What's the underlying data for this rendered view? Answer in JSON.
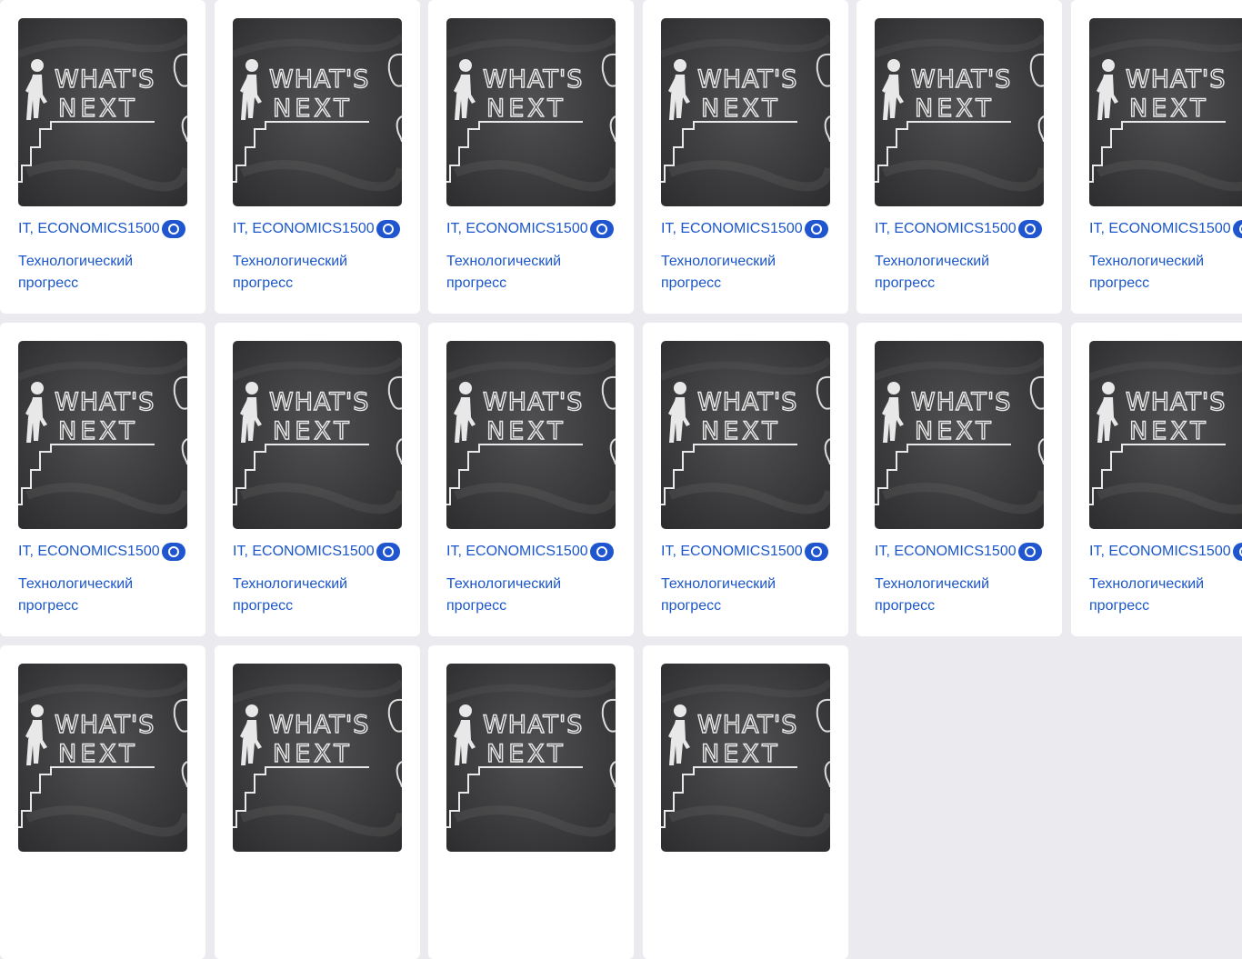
{
  "cards": [
    {
      "tags": "IT, ECONOMICS",
      "views": "1500",
      "title": "Технологический прогресс",
      "image": "chalkboard-whats-next"
    },
    {
      "tags": "IT, ECONOMICS",
      "views": "1500",
      "title": "Технологический прогресс",
      "image": "chalkboard-whats-next"
    },
    {
      "tags": "IT, ECONOMICS",
      "views": "1500",
      "title": "Технологический прогресс",
      "image": "chalkboard-whats-next"
    },
    {
      "tags": "IT, ECONOMICS",
      "views": "1500",
      "title": "Технологический прогресс",
      "image": "chalkboard-whats-next"
    },
    {
      "tags": "IT, ECONOMICS",
      "views": "1500",
      "title": "Технологический прогресс",
      "image": "chalkboard-whats-next"
    },
    {
      "tags": "IT, ECONOMICS",
      "views": "1500",
      "title": "Технологический прогресс",
      "image": "chalkboard-whats-next"
    },
    {
      "tags": "IT, ECONOMICS",
      "views": "1500",
      "title": "Технологический прогресс",
      "image": "chalkboard-whats-next"
    },
    {
      "tags": "IT, ECONOMICS",
      "views": "1500",
      "title": "Технологический прогресс",
      "image": "chalkboard-whats-next"
    },
    {
      "tags": "IT, ECONOMICS",
      "views": "1500",
      "title": "Технологический прогресс",
      "image": "chalkboard-whats-next"
    },
    {
      "tags": "IT, ECONOMICS",
      "views": "1500",
      "title": "Технологический прогресс",
      "image": "chalkboard-whats-next"
    },
    {
      "tags": "IT, ECONOMICS",
      "views": "1500",
      "title": "Технологический прогресс",
      "image": "chalkboard-whats-next"
    },
    {
      "tags": "IT, ECONOMICS",
      "views": "1500",
      "title": "Технологический прогресс",
      "image": "chalkboard-whats-next"
    },
    {
      "tags": "",
      "views": "",
      "title": "",
      "image": "chalkboard-whats-next"
    },
    {
      "tags": "",
      "views": "",
      "title": "",
      "image": "chalkboard-whats-next"
    },
    {
      "tags": "",
      "views": "",
      "title": "",
      "image": "chalkboard-whats-next"
    },
    {
      "tags": "",
      "views": "",
      "title": "",
      "image": "chalkboard-whats-next"
    }
  ],
  "colors": {
    "background": "#ebebef",
    "card": "#ffffff",
    "link": "#1a56c9",
    "eye_badge": "#1f55cf",
    "chalkboard": "#3a3a3c"
  },
  "icons": {
    "views": "eye-icon"
  },
  "image_text": "WHAT'S NEXT"
}
